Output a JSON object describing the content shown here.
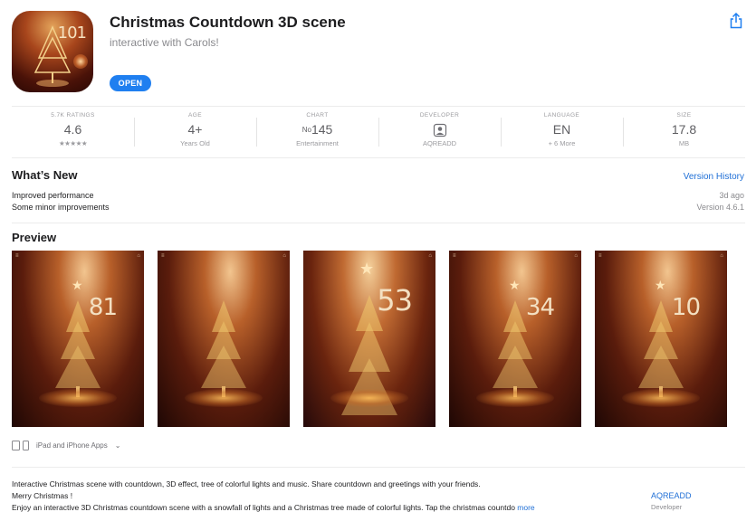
{
  "app": {
    "title": "Christmas Countdown 3D scene",
    "subtitle": "interactive with Carols!",
    "icon_number": "101",
    "open_label": "OPEN"
  },
  "stats": [
    {
      "label": "5.7K RATINGS",
      "value": "4.6",
      "sub": "★★★★★"
    },
    {
      "label": "AGE",
      "value": "4+",
      "sub": "Years Old"
    },
    {
      "label": "CHART",
      "prefix": "No",
      "value": "145",
      "sub": "Entertainment"
    },
    {
      "label": "DEVELOPER",
      "icon": "person-icon",
      "sub": "AQREADD"
    },
    {
      "label": "LANGUAGE",
      "value": "EN",
      "sub": "+ 6 More"
    },
    {
      "label": "SIZE",
      "value": "17.8",
      "sub": "MB"
    }
  ],
  "whats_new": {
    "title": "What’s New",
    "history_link": "Version History",
    "lines": [
      "Improved performance",
      "Some minor improvements"
    ],
    "date": "3d ago",
    "version": "Version 4.6.1"
  },
  "preview": {
    "title": "Preview",
    "screenshots": [
      {
        "count": "81"
      },
      {
        "count": ""
      },
      {
        "count": "53"
      },
      {
        "count": "34"
      },
      {
        "count": "10"
      }
    ],
    "devices_label": "iPad and iPhone Apps"
  },
  "description": {
    "line1": "Interactive Christmas scene with countdown, 3D effect, tree of colorful lights and music. Share countdown and greetings with your friends.",
    "line2": "Merry Christmas !",
    "line3": "Enjoy an interactive 3D Christmas countdown scene with a snowfall of lights and a Christmas tree made of colorful lights. Tap the christmas countdo",
    "more": "more",
    "developer_name": "AQREADD",
    "developer_label": "Developer"
  },
  "colors": {
    "accent": "#1f7ff0",
    "link": "#1f6fd6"
  }
}
